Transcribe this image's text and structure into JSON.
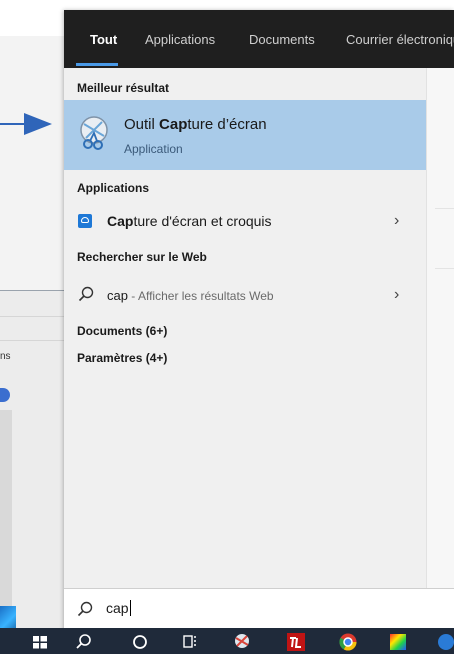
{
  "tabs": [
    {
      "label": "Tout",
      "active": true
    },
    {
      "label": "Applications",
      "active": false
    },
    {
      "label": "Documents",
      "active": false
    },
    {
      "label": "Courrier électronique",
      "active": false
    }
  ],
  "best_match": {
    "heading": "Meilleur résultat",
    "title_pre": "Outil ",
    "title_bold": "Cap",
    "title_post": "ture d’écran",
    "subtitle": "Application",
    "icon": "snipping-tool-icon"
  },
  "applications": {
    "heading": "Applications",
    "item": {
      "label_bold": "Cap",
      "label_rest": "ture d'écran et croquis",
      "icon": "snip-sketch-icon",
      "chevron": "›"
    }
  },
  "web": {
    "heading": "Rechercher sur le Web",
    "query": "cap",
    "suffix": " - Afficher les résultats Web",
    "chevron": "›"
  },
  "documents": {
    "heading": "Documents (6+)"
  },
  "settings": {
    "heading": "Paramètres (4+)"
  },
  "search": {
    "value": "cap"
  },
  "background": {
    "partial_text": "ns"
  },
  "colors": {
    "topbar": "#1f1f1f",
    "selection": "#a9cbe9",
    "accent": "#4a9ae8",
    "taskbar": "#1f2a3a",
    "arrow": "#2f65b9"
  }
}
